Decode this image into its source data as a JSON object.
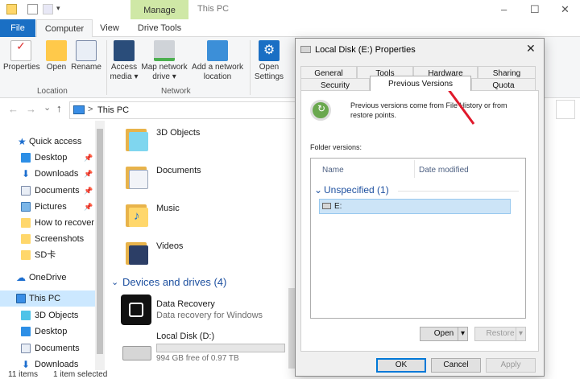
{
  "window": {
    "title": "This PC",
    "manage_tab": "Manage",
    "controls": {
      "minimize": "–",
      "maximize": "☐",
      "close": "✕"
    }
  },
  "ribbon": {
    "tabs": [
      "File",
      "Computer",
      "View",
      "Drive Tools"
    ],
    "location_group": {
      "label": "Location",
      "buttons": [
        "Properties",
        "Open",
        "Rename"
      ]
    },
    "network_group": {
      "label": "Network",
      "buttons": [
        {
          "line1": "Access",
          "line2": "media ▾"
        },
        {
          "line1": "Map network",
          "line2": "drive ▾"
        },
        {
          "line1": "Add a network",
          "line2": "location"
        }
      ]
    },
    "system_group": {
      "buttons": [
        {
          "line1": "Open",
          "line2": "Settings"
        }
      ]
    }
  },
  "address": {
    "path": "This PC",
    "nav": {
      "back": "←",
      "forward": "→",
      "dropdown": "⌄",
      "up": "↑",
      "arrow": ">"
    }
  },
  "nav_pane": {
    "items": [
      {
        "label": "Quick access",
        "pinned": false
      },
      {
        "label": "Desktop",
        "pinned": true
      },
      {
        "label": "Downloads",
        "pinned": true
      },
      {
        "label": "Documents",
        "pinned": true
      },
      {
        "label": "Pictures",
        "pinned": true
      },
      {
        "label": "How to recover",
        "pinned": false
      },
      {
        "label": "Screenshots",
        "pinned": false
      },
      {
        "label": "SD卡",
        "pinned": false
      },
      {
        "label": "OneDrive",
        "pinned": false
      },
      {
        "label": "This PC",
        "pinned": false
      },
      {
        "label": "3D Objects",
        "pinned": false
      },
      {
        "label": "Desktop",
        "pinned": false
      },
      {
        "label": "Documents",
        "pinned": false
      },
      {
        "label": "Downloads",
        "pinned": false
      }
    ],
    "colors": {
      "selected": "#cce8ff"
    }
  },
  "content": {
    "folders": [
      "3D Objects",
      "Documents",
      "Music",
      "Videos"
    ],
    "devices_header": "Devices and drives (4)",
    "devices": [
      {
        "name": "Data Recovery",
        "subtitle": "Data recovery for Windows"
      },
      {
        "name": "Local Disk (D:)",
        "subtitle": "994 GB free of 0.97 TB",
        "used_fraction": 0.0
      }
    ]
  },
  "statusbar": {
    "items_count": "11 items",
    "selected": "1 item selected"
  },
  "dialog": {
    "title": "Local Disk (E:) Properties",
    "close": "✕",
    "tabs_row1": [
      "General",
      "Tools",
      "Hardware",
      "Sharing"
    ],
    "tabs_row2": [
      "Security",
      "Previous Versions",
      "Quota"
    ],
    "active_tab": "Previous Versions",
    "info_text": "Previous versions come from File History or from restore points.",
    "folder_versions_label": "Folder versions:",
    "columns": [
      "Name",
      "Date modified"
    ],
    "group": "Unspecified (1)",
    "group_chevron": "⌄",
    "rows": [
      "E:"
    ],
    "buttons": {
      "open": "Open",
      "open_dropdown": "▾",
      "restore": "Restore",
      "restore_dropdown": "▾",
      "ok": "OK",
      "cancel": "Cancel",
      "apply": "Apply"
    },
    "colors": {
      "accent": "#0078d7",
      "selection": "#cce4f7",
      "arrow": "#e0192b"
    }
  }
}
